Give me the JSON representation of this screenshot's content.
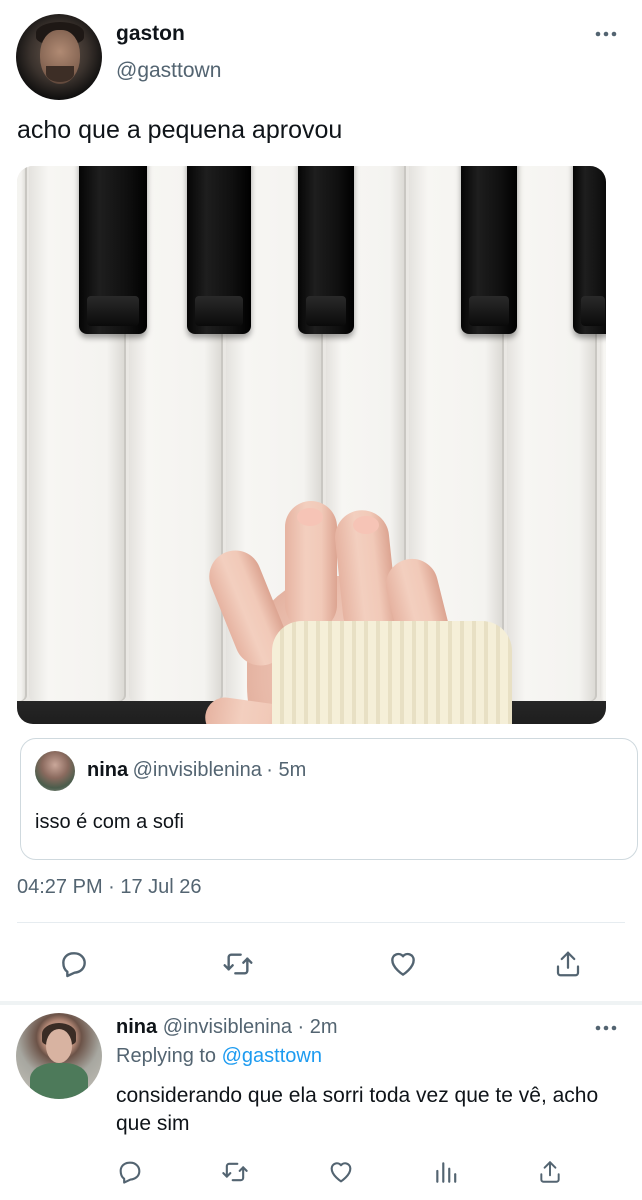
{
  "tweet": {
    "author_name": "gaston",
    "author_handle": "@gasttown",
    "more_icon": "more-dots-icon",
    "text": "acho que a pequena aprovou",
    "media_description_icon": "photo",
    "timestamp": "04:27 PM · 17 Jul 26"
  },
  "quote": {
    "author_name": "nina",
    "author_handle": "@invisiblenina",
    "time": "· 5m",
    "text": "isso é com a sofi"
  },
  "actions": {
    "icons": [
      "reply-icon",
      "retweet-icon",
      "like-icon",
      "share-icon"
    ]
  },
  "reply": {
    "author_name": "nina",
    "author_handle": "@invisiblenina",
    "time": "· 2m",
    "replying_prefix": "Replying to",
    "replying_to": "@gasttown",
    "text": "considerando que ela sorri toda vez que te vê, acho que sim",
    "icons": [
      "reply-icon",
      "retweet-icon",
      "like-icon",
      "analytics-icon",
      "share-icon"
    ]
  },
  "colors": {
    "text": "#0f1419",
    "secondary": "#536471",
    "link": "#1d9bf0",
    "border": "#cfd9de"
  }
}
